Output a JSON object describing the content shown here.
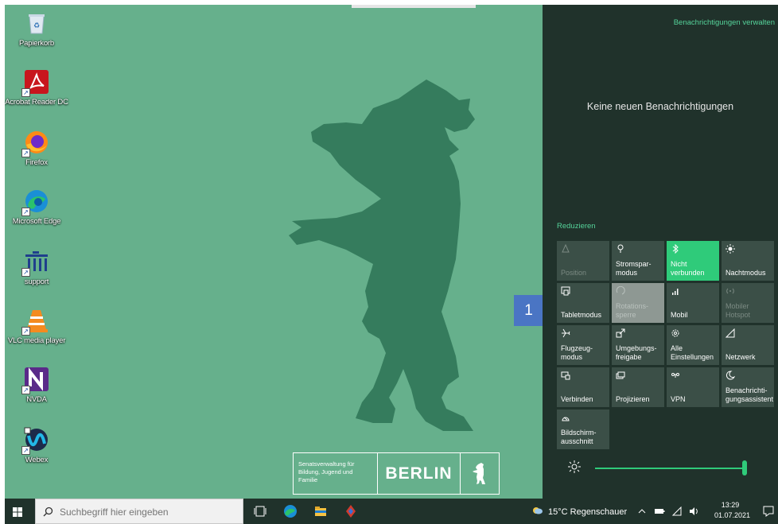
{
  "desktop": {
    "background_color": "#66b08c",
    "icons": [
      {
        "label": "Papierkorb",
        "icon": "recycle-bin-icon"
      },
      {
        "label": "Acrobat Reader DC",
        "icon": "acrobat-icon"
      },
      {
        "label": "Firefox",
        "icon": "firefox-icon"
      },
      {
        "label": "Microsoft Edge",
        "icon": "edge-icon"
      },
      {
        "label": "support",
        "icon": "support-icon"
      },
      {
        "label": "VLC media player",
        "icon": "vlc-icon"
      },
      {
        "label": "NVDA",
        "icon": "nvda-icon"
      },
      {
        "label": "Webex",
        "icon": "webex-icon"
      }
    ],
    "logo": {
      "department": "Senatsverwaltung für Bildung, Jugend und Familie",
      "city": "BERLIN"
    },
    "badge": "1"
  },
  "action_center": {
    "manage_link": "Benachrichtigungen verwalten",
    "empty_message": "Keine neuen Benachrichtigungen",
    "collapse_link": "Reduzieren",
    "accent_color": "#2fcb7a",
    "tiles": [
      {
        "label": "Position",
        "icon": "location-icon",
        "state": "disabled"
      },
      {
        "label": "Stromspar-modus",
        "icon": "battery-saver-icon",
        "state": "off"
      },
      {
        "label": "Nicht verbunden",
        "icon": "bluetooth-icon",
        "state": "on"
      },
      {
        "label": "Nachtmodus",
        "icon": "night-light-icon",
        "state": "off"
      },
      {
        "label": "Tabletmodus",
        "icon": "tablet-mode-icon",
        "state": "off"
      },
      {
        "label": "Rotations-sperre",
        "icon": "rotation-lock-icon",
        "state": "disabled-light"
      },
      {
        "label": "Mobil",
        "icon": "cellular-icon",
        "state": "off"
      },
      {
        "label": "Mobiler Hotspot",
        "icon": "hotspot-icon",
        "state": "disabled"
      },
      {
        "label": "Flugzeug-modus",
        "icon": "airplane-icon",
        "state": "off"
      },
      {
        "label": "Umgebungs-freigabe",
        "icon": "nearby-sharing-icon",
        "state": "off"
      },
      {
        "label": "Alle Einstellungen",
        "icon": "settings-gear-icon",
        "state": "off"
      },
      {
        "label": "Netzwerk",
        "icon": "network-icon",
        "state": "off"
      },
      {
        "label": "Verbinden",
        "icon": "connect-icon",
        "state": "off"
      },
      {
        "label": "Projizieren",
        "icon": "project-icon",
        "state": "off"
      },
      {
        "label": "VPN",
        "icon": "vpn-icon",
        "state": "off"
      },
      {
        "label": "Benachrichti-gungsassistent",
        "icon": "focus-assist-icon",
        "state": "off"
      },
      {
        "label": "Bildschirm-ausschnitt",
        "icon": "snip-icon",
        "state": "off"
      }
    ],
    "brightness": 1.0
  },
  "taskbar": {
    "search_placeholder": "Suchbegriff hier eingeben",
    "weather": "15°C Regenschauer",
    "time": "13:29",
    "date": "01.07.2021"
  }
}
